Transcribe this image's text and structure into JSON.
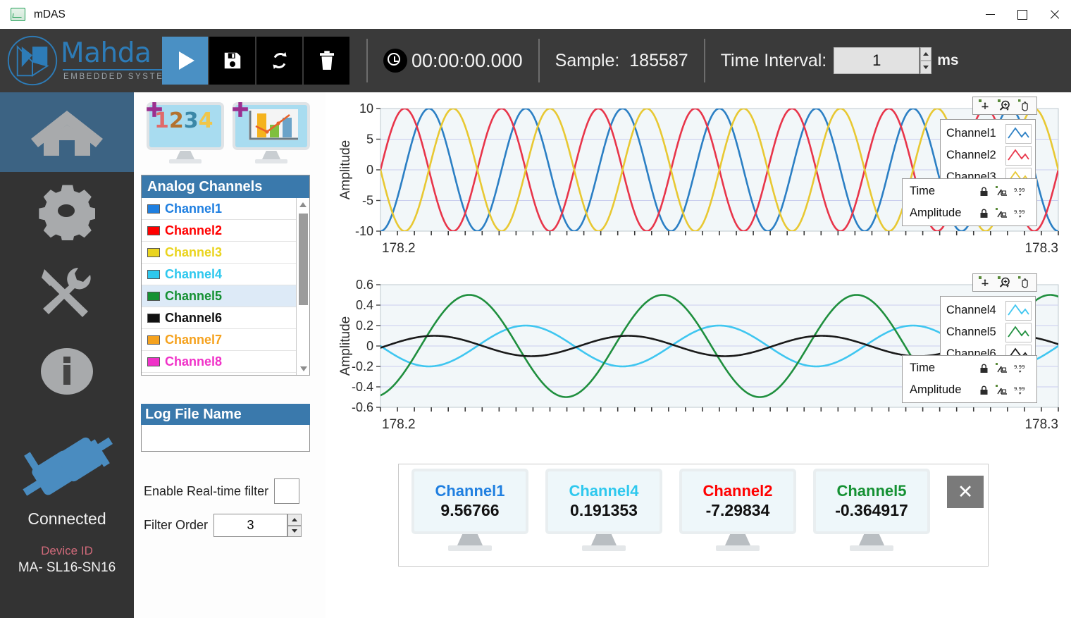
{
  "window": {
    "title": "mDAS",
    "app_icon": "mdas-icon",
    "minimize": "minimize-icon",
    "maximize": "maximize-icon",
    "close": "close-icon"
  },
  "header": {
    "brand_name": "Mahda",
    "brand_sub": "EMBEDDED SYSTEMS",
    "buttons": [
      {
        "name": "play-button",
        "icon": "play-icon"
      },
      {
        "name": "save-button",
        "icon": "floppy-disk-icon"
      },
      {
        "name": "refresh-button",
        "icon": "refresh-icon"
      },
      {
        "name": "delete-button",
        "icon": "trash-icon"
      }
    ],
    "clock_icon": "clock-icon",
    "elapsed_time": "00:00:00.000",
    "sample_label": "Sample:",
    "sample_value": "185587",
    "time_interval_label": "Time Interval:",
    "time_interval_value": "1",
    "time_interval_unit": "ms"
  },
  "rail": {
    "items": [
      {
        "name": "sidebar-item-home",
        "icon": "home-icon",
        "active": true
      },
      {
        "name": "sidebar-item-settings",
        "icon": "gear-icon",
        "active": false
      },
      {
        "name": "sidebar-item-tools",
        "icon": "tools-icon",
        "active": false
      },
      {
        "name": "sidebar-item-info",
        "icon": "info-icon",
        "active": false
      }
    ],
    "status_icon": "plug-connected-icon",
    "status_text": "Connected",
    "device_id_label": "Device ID",
    "device_id_value": "MA- SL16-SN16"
  },
  "panel": {
    "add_numeric_icon": "add-numeric-display-icon",
    "add_numeric_digits": "1234",
    "add_chart_icon": "add-chart-display-icon",
    "list_title": "Analog Channels",
    "channels": [
      {
        "label": "Channel1",
        "color": "#1f7fe0",
        "selected": false
      },
      {
        "label": "Channel2",
        "color": "#ff0000",
        "selected": false
      },
      {
        "label": "Channel3",
        "color": "#ead41f",
        "selected": false
      },
      {
        "label": "Channel4",
        "color": "#2ec8ee",
        "selected": false
      },
      {
        "label": "Channel5",
        "color": "#159133",
        "selected": true
      },
      {
        "label": "Channel6",
        "color": "#111111",
        "selected": false
      },
      {
        "label": "Channel7",
        "color": "#f5a21e",
        "selected": false
      },
      {
        "label": "Channel8",
        "color": "#f032c8",
        "selected": false
      }
    ],
    "log_title": "Log File Name",
    "log_value": "",
    "log_placeholder": "",
    "filter_label": "Enable Real-time filter",
    "filter_checked": false,
    "filter_order_label": "Filter Order",
    "filter_order_value": "3"
  },
  "charts": {
    "tools": [
      {
        "name": "cursor-tool-icon",
        "icon": "crosshair-icon"
      },
      {
        "name": "zoom-tool-icon",
        "icon": "magnifier-plus-icon"
      },
      {
        "name": "pan-tool-icon",
        "icon": "hand-icon"
      }
    ],
    "scale_rows": [
      {
        "label": "Time",
        "lock_icon": "lock-open-icon",
        "fit_icon": "autoscale-x-icon",
        "format_icon": "x-format-icon"
      },
      {
        "label": "Amplitude",
        "lock_icon": "lock-closed-icon",
        "fit_icon": "autoscale-y-icon",
        "format_icon": "y-format-icon"
      }
    ]
  },
  "chart_data": [
    {
      "type": "line",
      "id": "chart-top",
      "title": "",
      "xlabel": "",
      "ylabel": "Amplitude",
      "ylim": [
        -10,
        10
      ],
      "yticks": [
        10,
        5,
        0,
        -5,
        -10
      ],
      "ytick_labels": [
        "10",
        "5",
        "0",
        "-5",
        "-10"
      ],
      "xlim": [
        178.2,
        178.3
      ],
      "xtick_labels": [
        "178.2",
        "178.3"
      ],
      "grid": true,
      "legend_position": "top-right",
      "series": [
        {
          "name": "Channel1",
          "color": "#2b7fc4",
          "amplitude": 10,
          "periods": 7.0,
          "phase_deg": -90,
          "offset": 0
        },
        {
          "name": "Channel2",
          "color": "#e8354a",
          "amplitude": 10,
          "periods": 7.0,
          "phase_deg": 0,
          "offset": 0
        },
        {
          "name": "Channel3",
          "color": "#e8c832",
          "amplitude": 10,
          "periods": 7.0,
          "phase_deg": 180,
          "offset": 0
        }
      ]
    },
    {
      "type": "line",
      "id": "chart-bottom",
      "title": "",
      "xlabel": "",
      "ylabel": "Amplitude",
      "ylim": [
        -0.6,
        0.6
      ],
      "yticks": [
        0.6,
        0.4,
        0.2,
        0,
        -0.2,
        -0.4,
        -0.6
      ],
      "ytick_labels": [
        "0.6",
        "0.4",
        "0.2",
        "0",
        "-0.2",
        "-0.4",
        "-0.6"
      ],
      "xlim": [
        178.2,
        178.3
      ],
      "xtick_labels": [
        "178.2",
        "178.3"
      ],
      "grid": true,
      "legend_position": "top-right",
      "series": [
        {
          "name": "Channel4",
          "color": "#3fc6f0",
          "amplitude": 0.2,
          "periods": 3.5,
          "phase_deg": 180,
          "offset": 0
        },
        {
          "name": "Channel5",
          "color": "#1f8f3e",
          "amplitude": 0.5,
          "periods": 3.5,
          "phase_deg": -75,
          "offset": 0
        },
        {
          "name": "Channel6",
          "color": "#1a1a1a",
          "amplitude": 0.1,
          "periods": 3.5,
          "phase_deg": -10,
          "offset": 0
        }
      ]
    }
  ],
  "cards": {
    "close_icon": "close-icon",
    "items": [
      {
        "name": "Channel1",
        "value": "9.56766",
        "color": "#1f7fe0"
      },
      {
        "name": "Channel4",
        "value": "0.191353",
        "color": "#2ec8ee"
      },
      {
        "name": "Channel2",
        "value": "-7.29834",
        "color": "#ff0000"
      },
      {
        "name": "Channel5",
        "value": "-0.364917",
        "color": "#159133"
      }
    ]
  }
}
